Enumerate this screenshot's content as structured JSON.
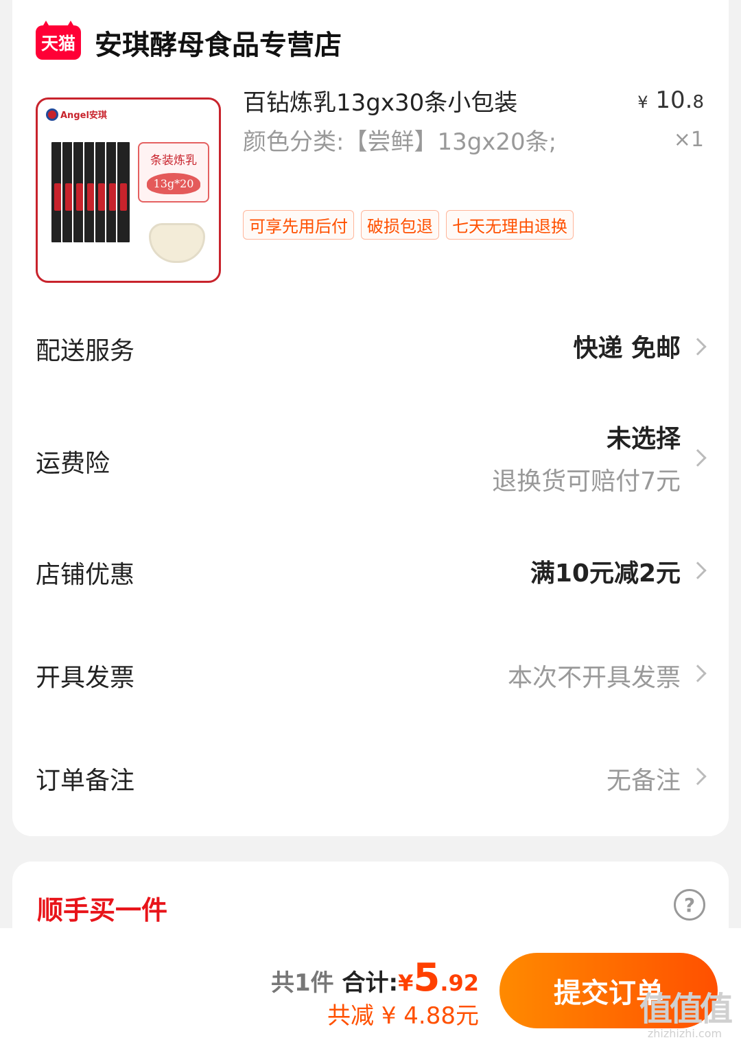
{
  "shop": {
    "badge": "天猫",
    "name": "安琪酵母食品专营店"
  },
  "product": {
    "brand": "Angel安琪",
    "image_label": "条装炼乳",
    "image_badge": "13g*20",
    "title": "百钻炼乳13gx30条小包装",
    "price_symbol": "¥",
    "price_int": "10.",
    "price_dec": "8",
    "spec": "颜色分类:【尝鲜】13gx20条;",
    "quantity": "×1",
    "tags": [
      "可享先用后付",
      "破损包退",
      "七天无理由退换"
    ]
  },
  "rows": {
    "delivery": {
      "label": "配送服务",
      "value": "快递 免邮"
    },
    "insurance": {
      "label": "运费险",
      "value": "未选择",
      "sub": "退换货可赔付7元"
    },
    "discount": {
      "label": "店铺优惠",
      "value": "满10元减2元"
    },
    "invoice": {
      "label": "开具发票",
      "value": "本次不开具发票"
    },
    "remark": {
      "label": "订单备注",
      "value": "无备注"
    }
  },
  "extra": {
    "title": "顺手买一件",
    "help": "?"
  },
  "footer": {
    "count": "共1件",
    "total_label": "合计:",
    "total_symbol": "¥",
    "total_int": "5",
    "total_dec": ".92",
    "saved": "共减 ¥ 4.88元",
    "submit": "提交订单"
  },
  "watermark": {
    "logo": "值值值",
    "text": "zhizhizhi.com"
  },
  "colors": {
    "accent": "#ff5000",
    "tmall_red": "#ff0036",
    "section_red": "#e8141a"
  }
}
